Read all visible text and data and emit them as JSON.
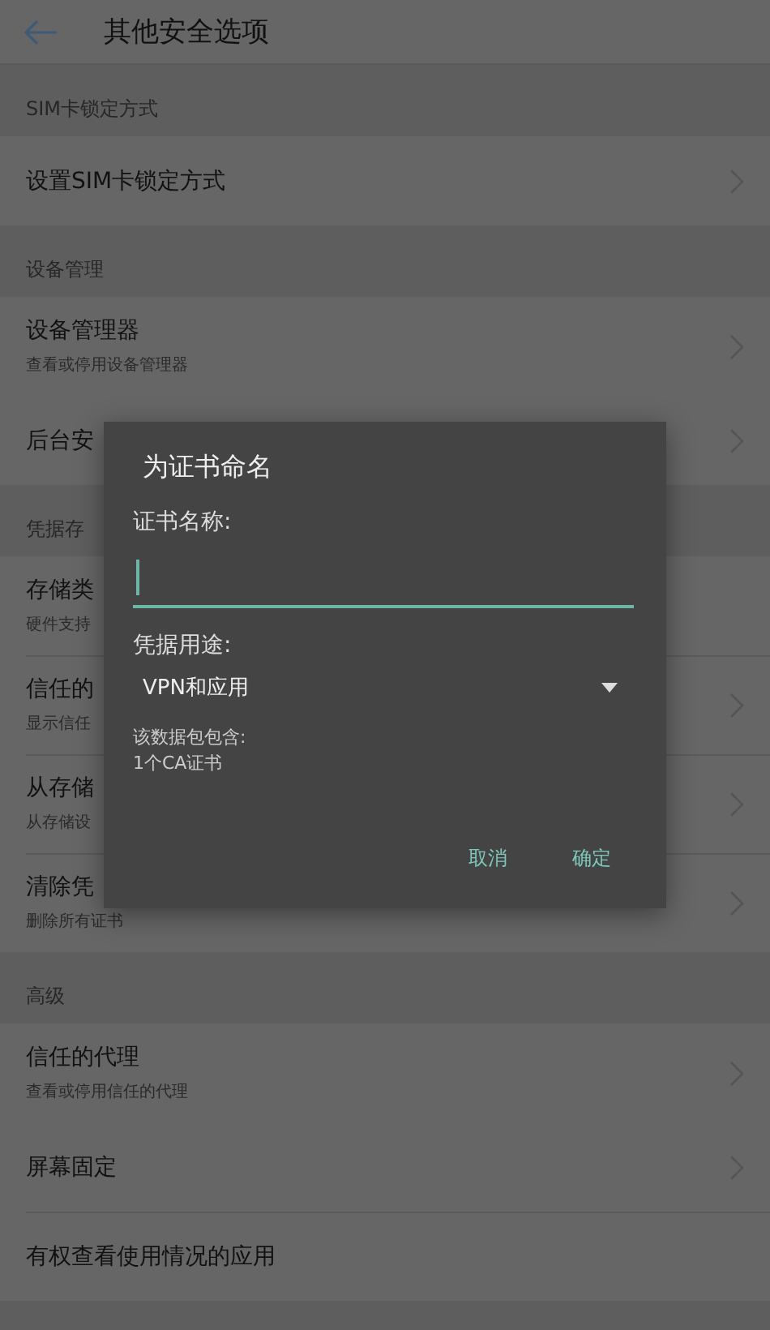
{
  "header": {
    "title": "其他安全选项"
  },
  "sections": [
    {
      "title": "SIM卡锁定方式",
      "items": [
        {
          "title": "设置SIM卡锁定方式",
          "chevron": true
        }
      ]
    },
    {
      "title": "设备管理",
      "items": [
        {
          "title": "设备管理器",
          "subtitle": "查看或停用设备管理器",
          "chevron": true
        },
        {
          "title": "后台安",
          "chevron": true
        }
      ]
    },
    {
      "title": "凭据存",
      "items": [
        {
          "title": "存储类",
          "subtitle": "硬件支持",
          "chevron": false
        },
        {
          "title": "信任的",
          "subtitle": "显示信任",
          "chevron": true
        },
        {
          "title": "从存储",
          "subtitle": "从存储设",
          "chevron": true
        },
        {
          "title": "清除凭",
          "subtitle": "删除所有证书",
          "chevron": true
        }
      ]
    },
    {
      "title": "高级",
      "items": [
        {
          "title": "信任的代理",
          "subtitle": "查看或停用信任的代理",
          "chevron": true
        },
        {
          "title": "屏幕固定",
          "chevron": true
        },
        {
          "title": "有权查看使用情况的应用",
          "chevron": false
        }
      ]
    }
  ],
  "dialog": {
    "title": "为证书命名",
    "name_label": "证书名称:",
    "usage_label": "凭据用途:",
    "usage_value": "VPN和应用",
    "info": [
      "该数据包包含:",
      "1个CA证书"
    ],
    "buttons": [
      "取消",
      "确定"
    ]
  }
}
